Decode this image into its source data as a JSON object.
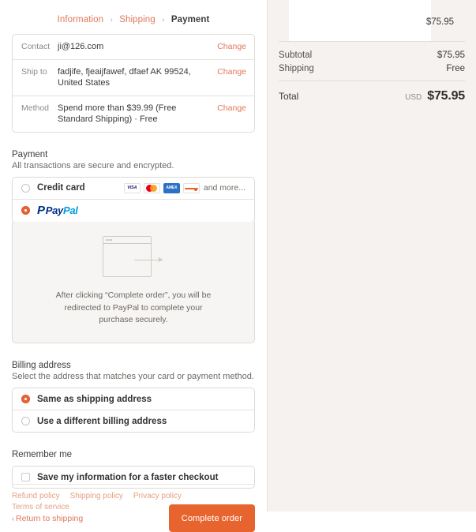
{
  "breadcrumb": {
    "items": [
      {
        "label": "Information",
        "current": false
      },
      {
        "label": "Shipping",
        "current": false
      },
      {
        "label": "Payment",
        "current": true
      }
    ],
    "separator": "›"
  },
  "review": {
    "change_label": "Change",
    "rows": [
      {
        "label": "Contact",
        "value": "ji@126.com"
      },
      {
        "label": "Ship to",
        "value": "fadjife, fjeaijfawef, dfaef AK 99524, United States"
      },
      {
        "label": "Method",
        "value": "Spend more than $39.99  (Free Standard Shipping)  · Free"
      }
    ]
  },
  "payment": {
    "title": "Payment",
    "subtitle": "All transactions are secure and encrypted.",
    "credit_card_label": "Credit card",
    "brands": [
      {
        "name": "visa-card-icon",
        "text": "VISA"
      },
      {
        "name": "mastercard-card-icon",
        "text": ""
      },
      {
        "name": "amex-card-icon",
        "text": "AMEX"
      },
      {
        "name": "discover-card-icon",
        "text": ""
      }
    ],
    "and_more": "and more...",
    "paypal": {
      "glyph": "P",
      "word_pay": "Pay",
      "word_pal": "Pal"
    },
    "redirect_text": "After clicking “Complete order”, you will be redirected to PayPal to complete your purchase securely.",
    "selected": "paypal"
  },
  "billing": {
    "title": "Billing address",
    "subtitle": "Select the address that matches your card or payment method.",
    "options": [
      {
        "label": "Same as shipping address",
        "checked": true
      },
      {
        "label": "Use a different billing address",
        "checked": false
      }
    ]
  },
  "remember": {
    "title": "Remember me",
    "checkbox_label": "Save my information for a faster checkout",
    "checked": false
  },
  "actions": {
    "return_label": "Return to shipping",
    "return_chevron": "‹",
    "complete_label": "Complete order"
  },
  "footer": {
    "links": [
      "Refund policy",
      "Shipping policy",
      "Privacy policy",
      "Terms of service"
    ]
  },
  "summary": {
    "item_price": "$75.95",
    "rows": [
      {
        "label": "Subtotal",
        "value": "$75.95"
      },
      {
        "label": "Shipping",
        "value": "Free"
      }
    ],
    "total_label": "Total",
    "total_currency": "USD",
    "total_value": "$75.95"
  },
  "colors": {
    "accent": "#e8642f",
    "link": "#e0785a",
    "sidebar_bg": "#f5f2f0",
    "border": "#e0dcd8"
  }
}
